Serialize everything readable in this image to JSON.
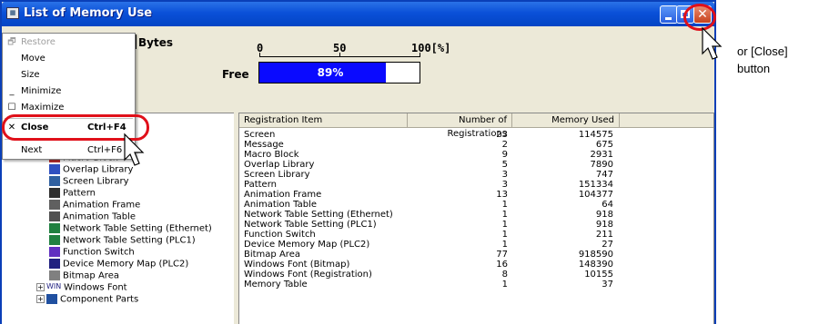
{
  "window": {
    "title": "List of Memory Use",
    "title_icon_glyph": "▦",
    "close_glyph": "✕"
  },
  "summary": {
    "bytes_label": "Bytes",
    "free_label": "Free",
    "scale_labels": [
      "0",
      "50",
      "100[%]"
    ],
    "free_percent_value": 89,
    "free_percent_text": "89%",
    "bar_color": "#0a0aff"
  },
  "system_menu": {
    "items": [
      {
        "icon": "🗗",
        "label": "Restore",
        "shortcut": "",
        "disabled": true
      },
      {
        "icon": "",
        "label": "Move",
        "shortcut": "",
        "disabled": false
      },
      {
        "icon": "",
        "label": "Size",
        "shortcut": "",
        "disabled": false
      },
      {
        "icon": "_",
        "label": "Minimize",
        "shortcut": "",
        "disabled": false
      },
      {
        "icon": "☐",
        "label": "Maximize",
        "shortcut": "",
        "disabled": false
      },
      {
        "icon": "✕",
        "label": "Close",
        "shortcut": "Ctrl+F4",
        "disabled": false
      },
      {
        "icon": "",
        "label": "Next",
        "shortcut": "Ctrl+F6",
        "disabled": false
      }
    ]
  },
  "tree": {
    "items": [
      {
        "label": "Macro Block",
        "icon": "macro-block-icon"
      },
      {
        "label": "Overlap Library",
        "icon": "overlap-library-icon"
      },
      {
        "label": "Screen Library",
        "icon": "screen-library-icon"
      },
      {
        "label": "Pattern",
        "icon": "pattern-icon"
      },
      {
        "label": "Animation Frame",
        "icon": "animation-frame-icon"
      },
      {
        "label": "Animation Table",
        "icon": "animation-table-icon"
      },
      {
        "label": "Network Table Setting (Ethernet)",
        "icon": "network-table-icon"
      },
      {
        "label": "Network Table Setting (PLC1)",
        "icon": "network-table-icon"
      },
      {
        "label": "Function Switch",
        "icon": "function-switch-icon"
      },
      {
        "label": "Device Memory Map (PLC2)",
        "icon": "device-memory-map-icon"
      },
      {
        "label": "Bitmap Area",
        "icon": "bitmap-area-icon"
      },
      {
        "label": "Windows Font",
        "icon": "windows-font-icon",
        "icon_text": "WIN",
        "expander": "+"
      },
      {
        "label": "Component Parts",
        "icon": "component-parts-icon",
        "expander": "+"
      }
    ]
  },
  "table": {
    "headers": [
      "Registration Item",
      "Number of Registrations",
      "Memory Used"
    ],
    "rows": [
      [
        "Screen",
        "23",
        "114575"
      ],
      [
        "Message",
        "2",
        "675"
      ],
      [
        "Macro Block",
        "9",
        "2931"
      ],
      [
        "Overlap Library",
        "5",
        "7890"
      ],
      [
        "Screen Library",
        "3",
        "747"
      ],
      [
        "Pattern",
        "3",
        "151334"
      ],
      [
        "Animation Frame",
        "13",
        "104377"
      ],
      [
        "Animation Table",
        "1",
        "64"
      ],
      [
        "Network Table Setting (Ethernet)",
        "1",
        "918"
      ],
      [
        "Network Table Setting (PLC1)",
        "1",
        "918"
      ],
      [
        "Function Switch",
        "1",
        "211"
      ],
      [
        "Device Memory Map (PLC2)",
        "1",
        "27"
      ],
      [
        "Bitmap Area",
        "77",
        "918590"
      ],
      [
        "Windows Font (Bitmap)",
        "16",
        "148390"
      ],
      [
        "Windows Font (Registration)",
        "8",
        "10155"
      ],
      [
        "Memory Table",
        "1",
        "37"
      ]
    ]
  },
  "annotation": {
    "line1": "or [Close]",
    "line2": "button"
  },
  "colors": {
    "highlight_ring": "#e0101a",
    "titlebar": "#0a50d8"
  }
}
